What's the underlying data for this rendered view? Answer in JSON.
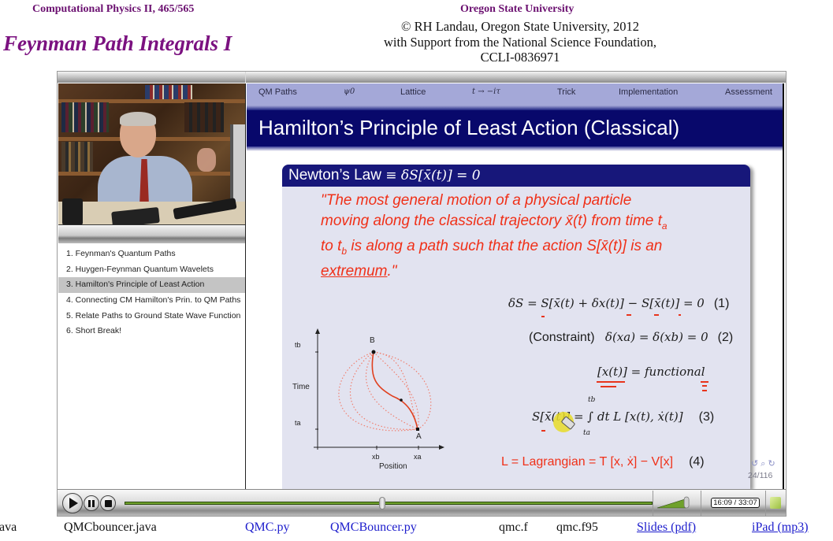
{
  "header": {
    "course": "Computational Physics II, 465/565",
    "title": "Feynman Path Integrals I",
    "university": "Oregon State University",
    "credits": [
      "© RH Landau, Oregon State University, 2012",
      "with Support from the National Science Foundation,",
      "CCLI-0836971"
    ]
  },
  "chapters": {
    "active_index": 2,
    "items": [
      "1. Feynman's Quantum Paths",
      "2. Huygen-Feynman Quantum Wavelets",
      "3. Hamilton's Principle of Least Action",
      "4. Connecting CM Hamilton's Prin. to QM Paths",
      "5. Relate Paths to Ground State Wave Function",
      "6. Short Break!"
    ]
  },
  "slide": {
    "nav": [
      "QM Paths",
      "ψ0",
      "Lattice",
      "t → −iτ",
      "Trick",
      "Implementation",
      "Assessment"
    ],
    "title": "Hamilton’s Principle of Least Action (Classical)",
    "block_title_text": "Newton’s Law",
    "block_title_math": "≡  δS[x̄(t)]  =  0",
    "quote": {
      "line1": "\"The most general motion of a physical particle",
      "line2": "moving along the classical trajectory x̄(t) from time t",
      "line2_sub": "a",
      "line3_pre": "to t",
      "line3_sub": "b",
      "line3_post": " is along a path such that the action S[x̄(t)] is an",
      "line4_word": "extremum",
      "line4_end": ".\""
    },
    "equations": [
      {
        "text": "δS = S[x̄(t) + δx(t)] − S[x̄(t)]  = 0",
        "number": "(1)"
      },
      {
        "label": "(Constraint)",
        "text": "δ(xa) = δ(xb)  = 0",
        "number": "(2)"
      },
      {
        "text": "[x(t)]  =  functional",
        "number": ""
      },
      {
        "text": "S[x̄(t)]  =  ∫ dt L [x(t), ẋ(t)]",
        "upper": "tb",
        "lower": "ta",
        "number": "(3)"
      },
      {
        "text": "L  =  Lagrangian  =  T [x, ẋ] − V[x]",
        "number": "(4)"
      }
    ],
    "diagram": {
      "ylabel": "Time",
      "xlabel": "Position",
      "y_ticks": [
        "tb",
        "ta"
      ],
      "x_ticks": [
        "xb",
        "xa"
      ],
      "points": [
        "B",
        "A"
      ]
    },
    "page": "24/116",
    "nav_symbols": "↺ ⌕ ↻"
  },
  "player": {
    "time": "16:09 / 33:07",
    "progress": 0.488,
    "volume": 0.95
  },
  "files": [
    {
      "label": "ava",
      "style": "plain"
    },
    {
      "label": "QMCbouncer.java",
      "style": "plain"
    },
    {
      "label": "QMC.py",
      "style": "link"
    },
    {
      "label": "QMCBouncer.py",
      "style": "link"
    },
    {
      "label": "qmc.f",
      "style": "plain"
    },
    {
      "label": "qmc.f95",
      "style": "plain"
    },
    {
      "label": "Slides (pdf)",
      "style": "ulink"
    },
    {
      "label": "iPad (mp3)",
      "style": "ulink"
    }
  ],
  "colors": {
    "title_purple": "#7b1180",
    "slide_navy": "#08086b",
    "accent_red": "#f03018",
    "seek_green": "#6fa12b"
  }
}
